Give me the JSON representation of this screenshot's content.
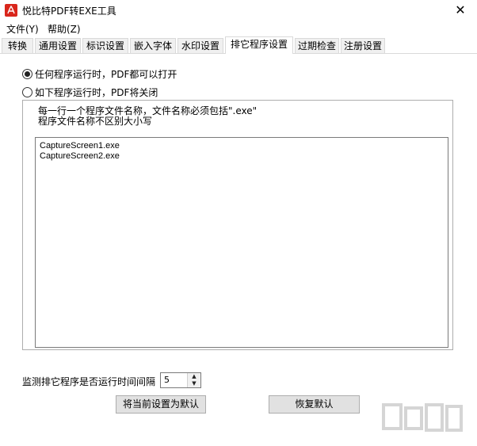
{
  "window": {
    "title": "悦比特PDF转EXE工具",
    "close_glyph": "✕"
  },
  "menu": {
    "items": [
      {
        "label": "文件(Y)"
      },
      {
        "label": "帮助(Z)"
      }
    ]
  },
  "tabs": [
    {
      "label": "转换"
    },
    {
      "label": "通用设置"
    },
    {
      "label": "标识设置"
    },
    {
      "label": "嵌入字体"
    },
    {
      "label": "水印设置"
    },
    {
      "label": "排它程序设置",
      "active": true
    },
    {
      "label": "过期检查"
    },
    {
      "label": "注册设置"
    }
  ],
  "options": {
    "allow_any": {
      "label": "任何程序运行时，PDF都可以打开",
      "checked": true
    },
    "close_when": {
      "label": "如下程序运行时，PDF将关闭",
      "checked": false
    }
  },
  "hint": {
    "line1": "每一行一个程序文件名称，文件名称必须包括\".exe\"",
    "line2": "程序文件名称不区别大小写"
  },
  "program_list": [
    "CaptureScreen1.exe",
    "CaptureScreen2.exe"
  ],
  "interval": {
    "label": "监测排它程序是否运行时间间隔",
    "value": "5",
    "up_glyph": "▲",
    "down_glyph": "▼"
  },
  "buttons": {
    "set_default": "将当前设置为默认",
    "restore_default": "恢复默认"
  },
  "colors": {
    "app_icon": "#d9261c",
    "button_bg": "#e1e1e1",
    "tab_bg": "#f0f0f0"
  }
}
